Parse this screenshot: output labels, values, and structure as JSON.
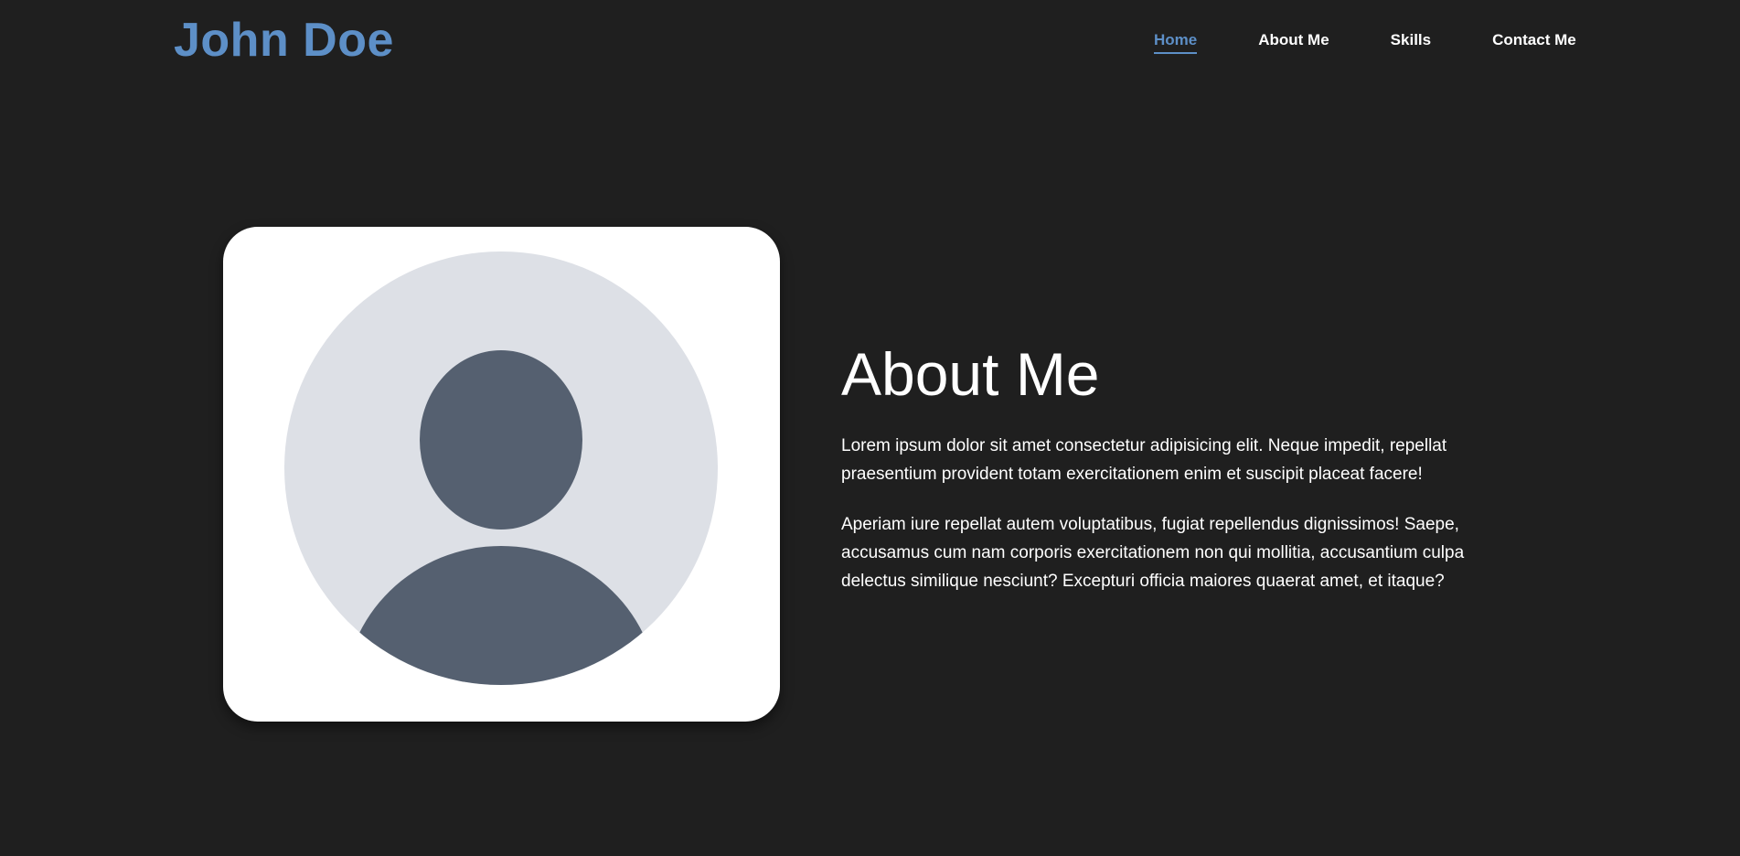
{
  "header": {
    "logo": "John Doe",
    "nav": [
      {
        "label": "Home",
        "active": true
      },
      {
        "label": "About Me",
        "active": false
      },
      {
        "label": "Skills",
        "active": false
      },
      {
        "label": "Contact Me",
        "active": false
      }
    ]
  },
  "about": {
    "image_icon": "user-avatar-icon",
    "title": "About Me",
    "paragraphs": [
      "Lorem ipsum dolor sit amet consectetur adipisicing elit. Neque impedit, repellat praesentium provident totam exercitationem enim et suscipit placeat facere!",
      "Aperiam iure repellat autem voluptatibus, fugiat repellendus dignissimos! Saepe, accusamus cum nam corporis exercitationem non qui mollitia, accusantium culpa delectus similique nesciunt? Excepturi officia maiores quaerat amet, et itaque?"
    ]
  },
  "colors": {
    "background": "#1f1f1f",
    "accent": "#5d8fc7",
    "text": "#ffffff",
    "card": "#ffffff",
    "avatar_bg": "#dde0e6",
    "avatar_figure": "#556070"
  }
}
